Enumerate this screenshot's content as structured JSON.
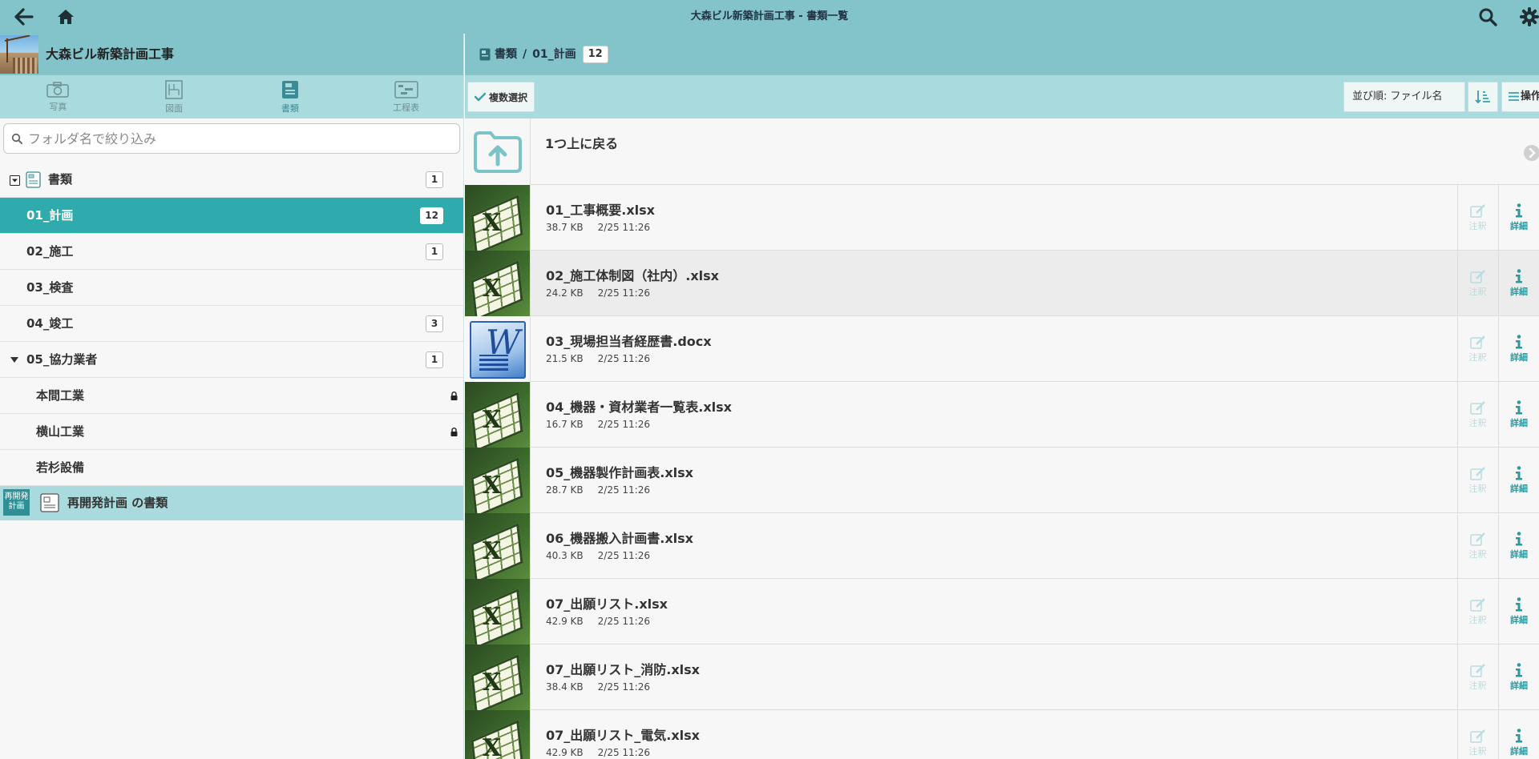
{
  "topbar": {
    "title": "大森ビル新築計画工事 - 書類一覧"
  },
  "project": {
    "name": "大森ビル新築計画工事"
  },
  "tabs": [
    {
      "label": "写真",
      "icon": "camera-icon",
      "active": false
    },
    {
      "label": "図面",
      "icon": "drawing-icon",
      "active": false
    },
    {
      "label": "書類",
      "icon": "document-icon",
      "active": true
    },
    {
      "label": "工程表",
      "icon": "schedule-icon",
      "active": false
    }
  ],
  "search": {
    "placeholder": "フォルダ名で絞り込み",
    "value": ""
  },
  "tree": {
    "root": {
      "label": "書類",
      "count": "1"
    },
    "folders": [
      {
        "label": "01_計画",
        "count": "12",
        "selected": true
      },
      {
        "label": "02_施工",
        "count": "1"
      },
      {
        "label": "03_検査",
        "count": ""
      },
      {
        "label": "04_竣工",
        "count": "3"
      },
      {
        "label": "05_協力業者",
        "count": "1"
      }
    ],
    "subfolders": [
      {
        "label": "本間工業",
        "locked": true
      },
      {
        "label": "横山工業",
        "locked": true
      },
      {
        "label": "若杉設備",
        "locked": false
      }
    ],
    "other_project": {
      "thumb_label": "再開発計画",
      "label": "再開発計画 の書類"
    }
  },
  "breadcrumb": {
    "root": "書類",
    "separator": "/",
    "current": "01_計画",
    "count": "12"
  },
  "toolbar": {
    "multi_select_label": "複数選択",
    "sort_label": "並び順: ファイル名",
    "ops_label": "操作"
  },
  "list": {
    "up_label": "1つ上に戻る",
    "note_label": "注釈",
    "detail_label": "詳細",
    "files": [
      {
        "name": "01_工事概要.xlsx",
        "size": "38.7 KB",
        "date": "2/25 11:26",
        "type": "xlsx"
      },
      {
        "name": "02_施工体制図（社内）.xlsx",
        "size": "24.2 KB",
        "date": "2/25 11:26",
        "type": "xlsx"
      },
      {
        "name": "03_現場担当者経歴書.docx",
        "size": "21.5 KB",
        "date": "2/25 11:26",
        "type": "docx"
      },
      {
        "name": "04_機器・資材業者一覧表.xlsx",
        "size": "16.7 KB",
        "date": "2/25 11:26",
        "type": "xlsx"
      },
      {
        "name": "05_機器製作計画表.xlsx",
        "size": "28.7 KB",
        "date": "2/25 11:26",
        "type": "xlsx"
      },
      {
        "name": "06_機器搬入計画書.xlsx",
        "size": "40.3 KB",
        "date": "2/25 11:26",
        "type": "xlsx"
      },
      {
        "name": "07_出願リスト.xlsx",
        "size": "42.9 KB",
        "date": "2/25 11:26",
        "type": "xlsx"
      },
      {
        "name": "07_出願リスト_消防.xlsx",
        "size": "38.4 KB",
        "date": "2/25 11:26",
        "type": "xlsx"
      },
      {
        "name": "07_出願リスト_電気.xlsx",
        "size": "42.9 KB",
        "date": "2/25 11:26",
        "type": "xlsx"
      }
    ]
  },
  "colors": {
    "header": "#82c4c9",
    "subheader": "#a9dadd",
    "selected": "#2faaad",
    "accent": "#2a9aa0"
  }
}
